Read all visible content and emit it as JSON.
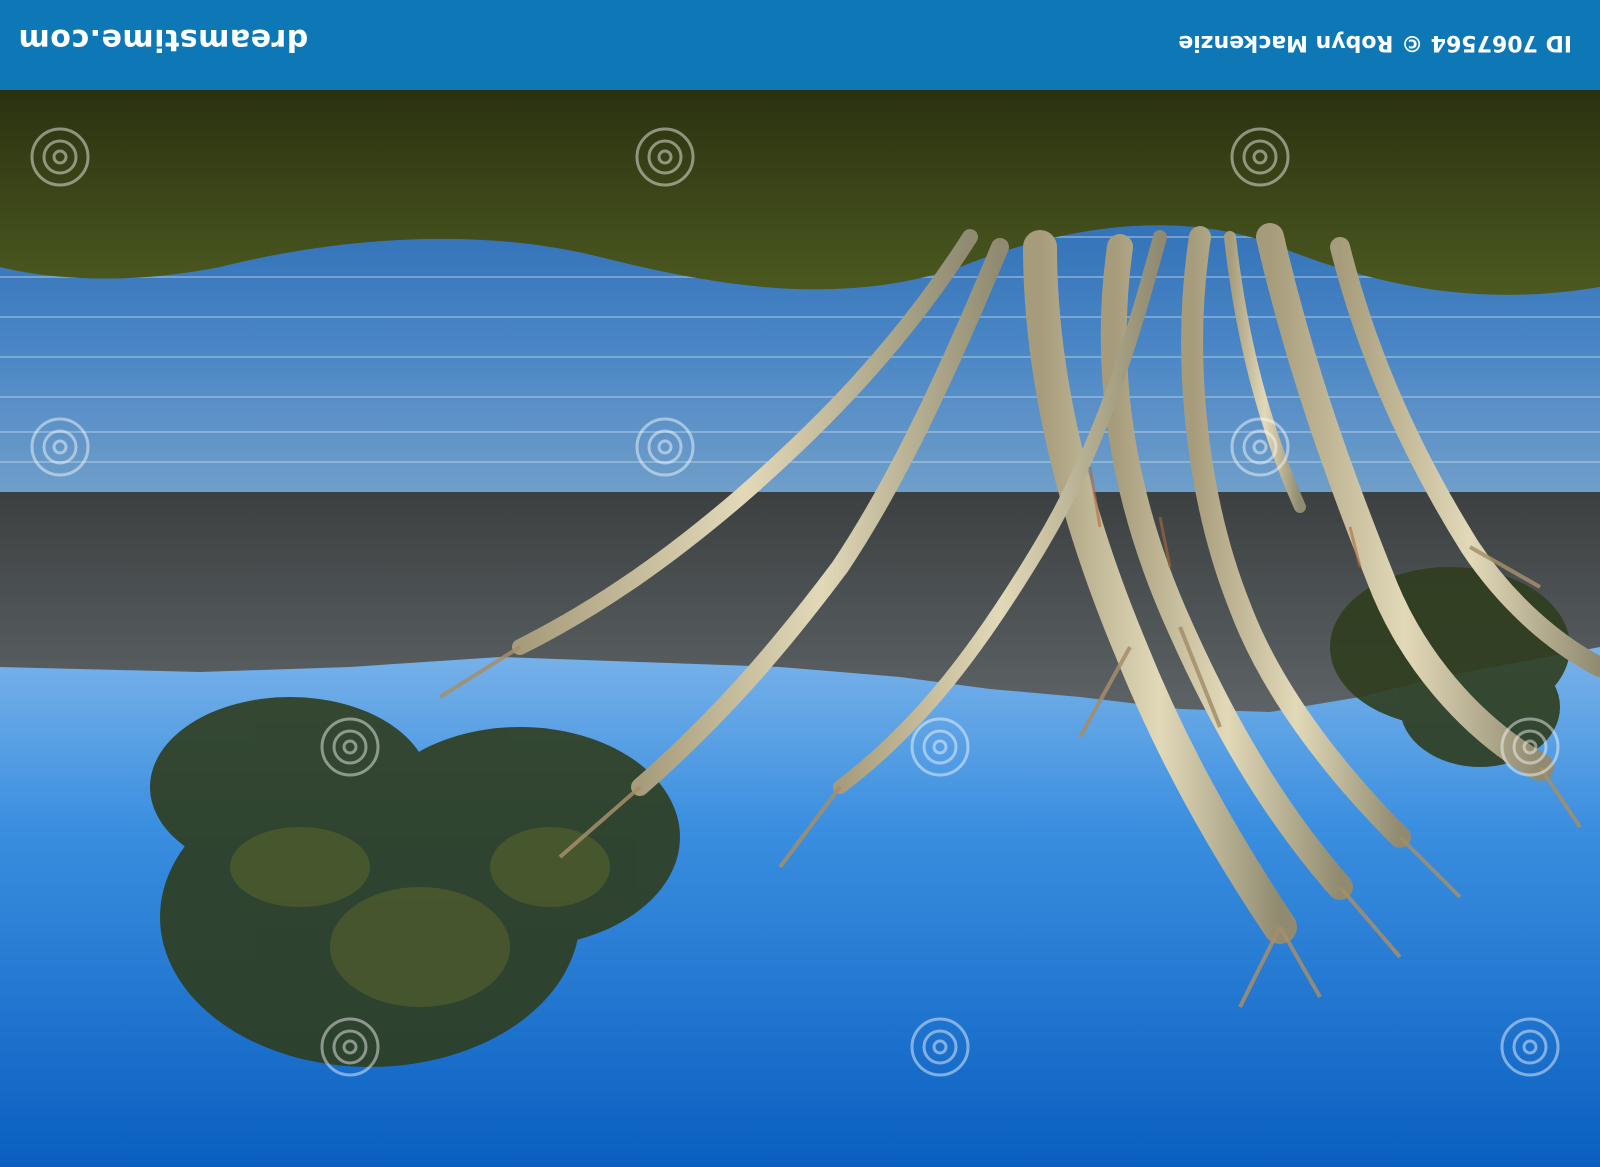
{
  "image": {
    "orientation": "upside-down",
    "subject": "snow gum tree by lake with mountain reflection",
    "colors": {
      "sky_top": "#0a5fc0",
      "sky_bottom": "#7fb4e8",
      "lake": "#3f7fc6",
      "mountain": "#4a4f52",
      "grass": "#3f4a18",
      "trunk": "#c9c0a1",
      "foliage": "#2f3d1e",
      "bar": "#0e78b6"
    }
  },
  "watermark": {
    "site": "dreamstime.com",
    "credit": "ID 7067564 © Robyn Mackenzie",
    "logo_icon": "swirl-logo-icon"
  }
}
